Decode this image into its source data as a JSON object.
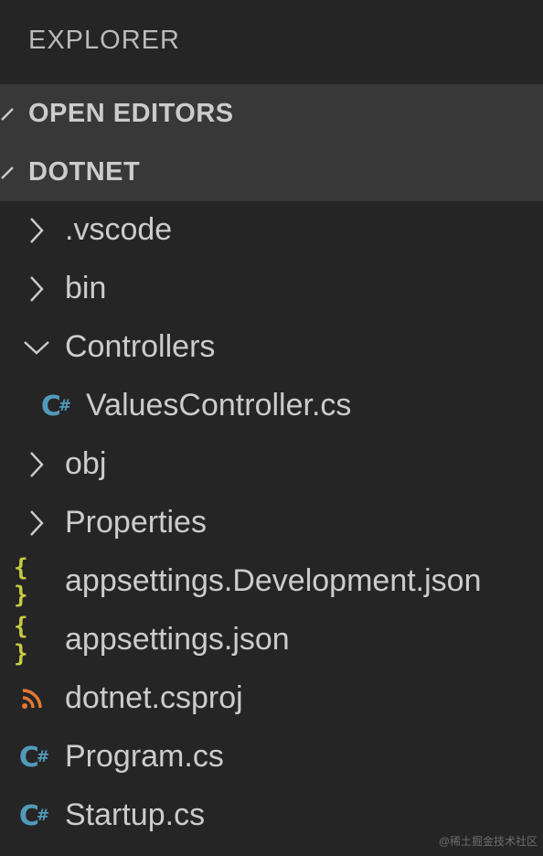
{
  "explorer": {
    "title": "EXPLORER"
  },
  "sections": {
    "open_editors": {
      "label": "OPEN EDITORS",
      "icon": "chevron-collapsed-icon"
    },
    "dotnet": {
      "label": "DOTNET",
      "icon": "chevron-expanded-icon"
    }
  },
  "tree": [
    {
      "label": ".vscode",
      "kind": "folder",
      "expanded": false,
      "icon": "chevron-right-icon"
    },
    {
      "label": "bin",
      "kind": "folder",
      "expanded": false,
      "icon": "chevron-right-icon"
    },
    {
      "label": "Controllers",
      "kind": "folder",
      "expanded": true,
      "icon": "chevron-down-icon"
    },
    {
      "label": "ValuesController.cs",
      "kind": "file",
      "icon": "csharp-file-icon"
    },
    {
      "label": "obj",
      "kind": "folder",
      "expanded": false,
      "icon": "chevron-right-icon"
    },
    {
      "label": "Properties",
      "kind": "folder",
      "expanded": false,
      "icon": "chevron-right-icon"
    },
    {
      "label": "appsettings.Development.json",
      "kind": "file",
      "icon": "json-file-icon"
    },
    {
      "label": "appsettings.json",
      "kind": "file",
      "icon": "json-file-icon"
    },
    {
      "label": "dotnet.csproj",
      "kind": "file",
      "icon": "rss-file-icon"
    },
    {
      "label": "Program.cs",
      "kind": "file",
      "icon": "csharp-file-icon"
    },
    {
      "label": "Startup.cs",
      "kind": "file",
      "icon": "csharp-file-icon"
    }
  ],
  "colors": {
    "background": "#252526",
    "section_header": "#383838",
    "text": "#cccccc",
    "json_icon": "#cbcb41",
    "csharp_icon": "#519aba",
    "rss_icon": "#e37933"
  },
  "icon_glyphs": {
    "json": "{ }",
    "csharp": "C",
    "csharp_sup": "#"
  },
  "watermark": "@稀土掘金技术社区"
}
